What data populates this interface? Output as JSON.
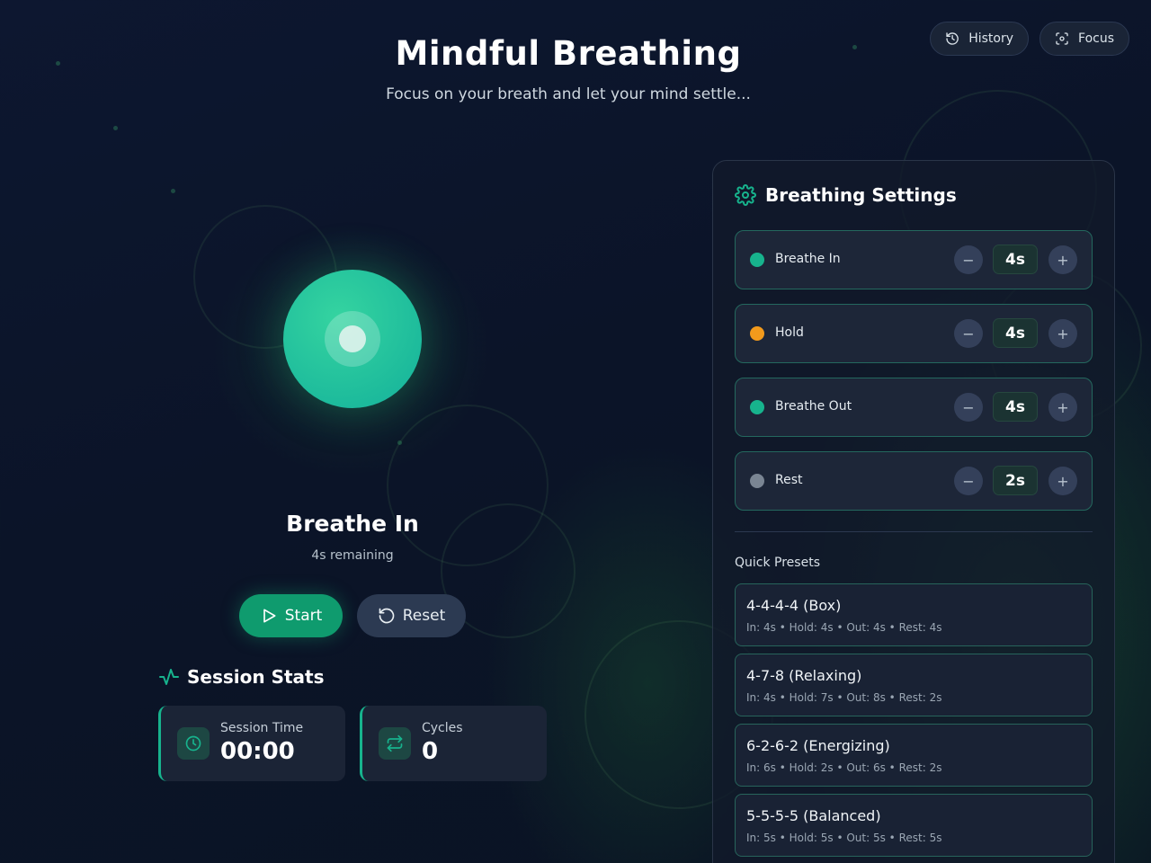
{
  "header": {
    "title": "Mindful Breathing",
    "subtitle": "Focus on your breath and let your mind settle..."
  },
  "top_buttons": {
    "history_label": "History",
    "focus_label": "Focus"
  },
  "breath": {
    "phase": "Breathe In",
    "remaining": "4s remaining"
  },
  "controls": {
    "start_label": "Start",
    "reset_label": "Reset"
  },
  "stats": {
    "title": "Session Stats",
    "session_time_label": "Session Time",
    "session_time_value": "00:00",
    "cycles_label": "Cycles",
    "cycles_value": "0"
  },
  "settings": {
    "title": "Breathing Settings",
    "items": [
      {
        "label": "Breathe In",
        "value": "4s",
        "color": "#17b38d"
      },
      {
        "label": "Hold",
        "value": "4s",
        "color": "#f29a1c"
      },
      {
        "label": "Breathe Out",
        "value": "4s",
        "color": "#17b38d"
      },
      {
        "label": "Rest",
        "value": "2s",
        "color": "#7a8593"
      }
    ],
    "minus_glyph": "−",
    "plus_glyph": "+"
  },
  "presets": {
    "label": "Quick Presets",
    "items": [
      {
        "name": "4-4-4-4 (Box)",
        "detail": "In: 4s • Hold: 4s • Out: 4s • Rest: 4s"
      },
      {
        "name": "4-7-8 (Relaxing)",
        "detail": "In: 4s • Hold: 7s • Out: 8s • Rest: 2s"
      },
      {
        "name": "6-2-6-2 (Energizing)",
        "detail": "In: 6s • Hold: 2s • Out: 6s • Rest: 2s"
      },
      {
        "name": "5-5-5-5 (Balanced)",
        "detail": "In: 5s • Hold: 5s • Out: 5s • Rest: 5s"
      }
    ]
  },
  "colors": {
    "accent": "#17b38d",
    "hold": "#f29a1c",
    "rest": "#7a8593"
  },
  "icons": [
    "history-icon",
    "focus-icon",
    "play-icon",
    "reset-icon",
    "activity-icon",
    "clock-icon",
    "repeat-icon",
    "gear-icon",
    "minus-icon",
    "plus-icon"
  ]
}
